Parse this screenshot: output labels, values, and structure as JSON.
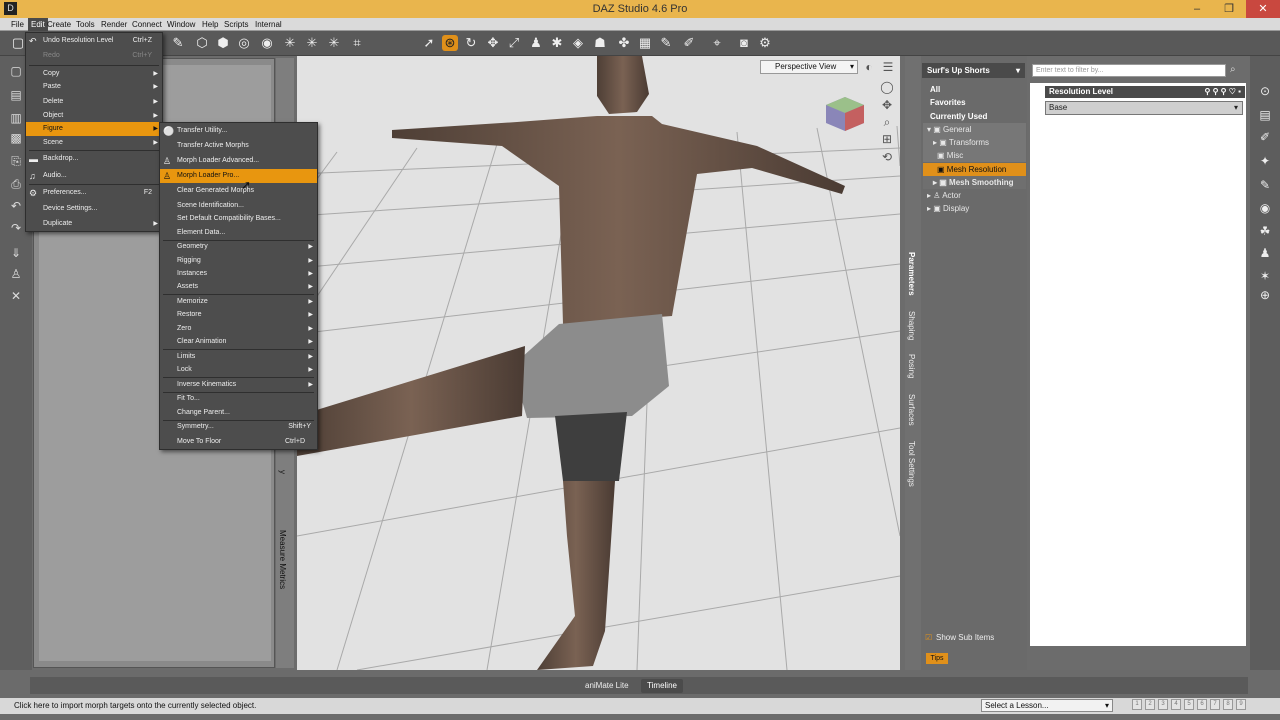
{
  "window": {
    "title": "DAZ Studio 4.6 Pro",
    "logo": "D",
    "controls": [
      "–",
      "❐",
      "✕"
    ]
  },
  "menubar": [
    "File",
    "Edit",
    "Create",
    "Tools",
    "Render",
    "Connect",
    "Window",
    "Help",
    "Scripts",
    "Internal"
  ],
  "edit_menu": {
    "items": [
      {
        "label": "Undo Resolution Level",
        "shortcut": "Ctrl+Z"
      },
      {
        "label": "Redo",
        "shortcut": "Ctrl+Y"
      },
      {
        "label": "Copy"
      },
      {
        "label": "Paste"
      },
      {
        "label": "Delete"
      },
      {
        "label": "Object"
      },
      {
        "label": "Figure"
      },
      {
        "label": "Scene"
      },
      {
        "label": "Backdrop..."
      },
      {
        "label": "Audio..."
      },
      {
        "label": "Preferences...",
        "shortcut": "F2"
      },
      {
        "label": "Device Settings..."
      },
      {
        "label": "Duplicate"
      }
    ]
  },
  "figure_menu": {
    "items": [
      "Transfer Utility...",
      "Transfer Active Morphs",
      "Morph Loader Advanced...",
      "Morph Loader Pro...",
      "Clear Generated Morphs",
      "Scene Identification...",
      "Set Default Compatibility Bases...",
      "Element Data...",
      "Geometry",
      "Rigging",
      "Instances",
      "Assets",
      "Memorize",
      "Restore",
      "Zero",
      "Clear Animation",
      "Limits",
      "Lock",
      "Inverse Kinematics",
      "Fit To...",
      "Change Parent...",
      "Symmetry...",
      "Move To Floor"
    ],
    "shortcuts": {
      "symmetry": "Shift+Y",
      "floor": "Ctrl+D"
    }
  },
  "viewport": {
    "camera": "Perspective View"
  },
  "left_tabs": [
    "Measure Metrics",
    "y"
  ],
  "right_tabs": [
    "Parameters",
    "Shaping",
    "Posing",
    "Surfaces",
    "Tool Settings"
  ],
  "params": {
    "node": "Surf's Up Shorts",
    "categories": [
      "All",
      "Favorites",
      "Currently Used"
    ],
    "tree": [
      "General",
      "Transforms",
      "Misc",
      "Mesh Resolution",
      "Mesh Smoothing",
      "Actor",
      "Display"
    ],
    "filter_placeholder": "Enter text to filter by...",
    "property": "Resolution Level",
    "value": "Base",
    "show_sub": "Show Sub Items",
    "tips": "Tips"
  },
  "timeline": {
    "animate": "aniMate Lite",
    "tab": "Timeline"
  },
  "status": {
    "text": "Click here to import morph targets onto the currently selected object.",
    "lesson": "Select a Lesson...",
    "pages": [
      "1",
      "2",
      "3",
      "4",
      "5",
      "6",
      "7",
      "8",
      "9"
    ]
  },
  "colors": {
    "accent": "#e8960f",
    "titlebar": "#e9b54d"
  }
}
